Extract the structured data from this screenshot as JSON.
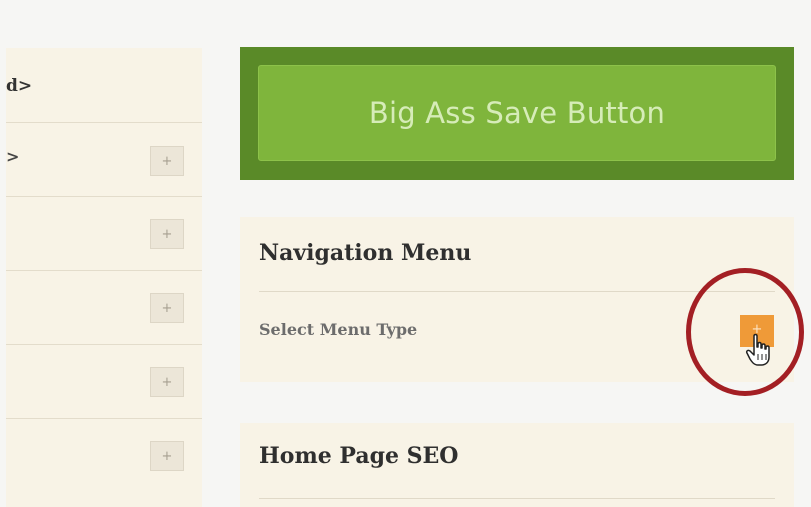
{
  "left_panel": {
    "header_text": "d>",
    "rows": [
      {
        "text": ">",
        "button": "+"
      },
      {
        "text": "",
        "button": "+"
      },
      {
        "text": "",
        "button": "+"
      },
      {
        "text": "",
        "button": "+"
      },
      {
        "text": "",
        "button": "+"
      }
    ]
  },
  "save_button": {
    "label": "Big Ass Save Button"
  },
  "navigation_menu": {
    "title": "Navigation Menu",
    "select_label": "Select Menu Type",
    "button": "+"
  },
  "home_page_seo": {
    "title": "Home Page SEO"
  },
  "colors": {
    "panel_bg": "#f8f3e6",
    "save_outer": "#5a8a28",
    "save_inner": "#7fb53c",
    "orange_button": "#ef9a38",
    "highlight_circle": "#a31f24"
  },
  "icons": {
    "plus": "plus-icon",
    "cursor": "hand-pointer-icon"
  }
}
